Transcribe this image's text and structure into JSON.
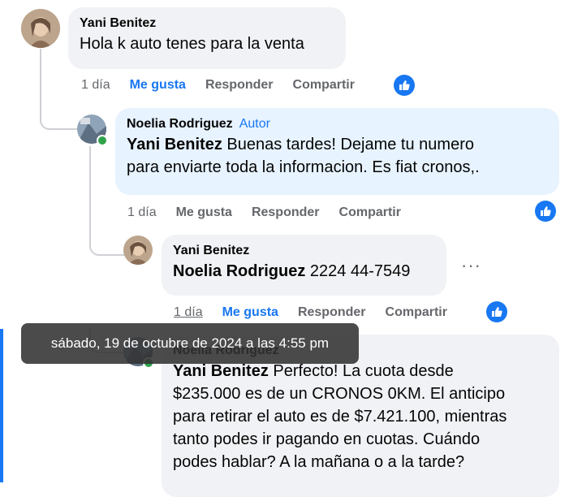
{
  "comments": [
    {
      "author": "Yani Benitez",
      "badge": "",
      "mention": "",
      "text": "Hola k auto tenes para la venta",
      "time": "1 día",
      "like": "Me gusta",
      "reply": "Responder",
      "share": "Compartir"
    },
    {
      "author": "Noelia Rodriguez",
      "badge": "Autor",
      "mention": "Yani Benitez",
      "text_line1": " Buenas tardes! Dejame tu numero",
      "text_line2": "para enviarte toda la informacion. Es fiat cronos,.",
      "time": "1 día",
      "like": "Me gusta",
      "reply": "Responder",
      "share": "Compartir"
    },
    {
      "author": "Yani Benitez",
      "mention": "Noelia Rodriguez",
      "text": " 2224 44-7549",
      "time": "1 día",
      "like": "Me gusta",
      "reply": "Responder",
      "share": "Compartir",
      "more": "···"
    },
    {
      "author": "Noelia Rodriguez",
      "mention": "Yani Benitez",
      "text_line1": " Perfecto! La cuota desde",
      "text_line2": "$235.000 es de un CRONOS 0KM. El anticipo",
      "text_line3": "para retirar el auto es de $7.421.100, mientras",
      "text_line4": "tanto podes ir pagando en cuotas. Cuándo",
      "text_line5": "podes hablar? A la mañana o a la tarde?"
    }
  ],
  "tooltip": "sábado, 19 de octubre de 2024 a las 4:55 pm",
  "colors": {
    "accent": "#1877f2",
    "bubble_grey": "#f0f2f5",
    "bubble_blue": "#e7f3ff",
    "muted": "#65676b",
    "online": "#31a24c"
  },
  "icons": [
    "thumbs-up-icon",
    "more-options-icon",
    "avatar-icon"
  ]
}
